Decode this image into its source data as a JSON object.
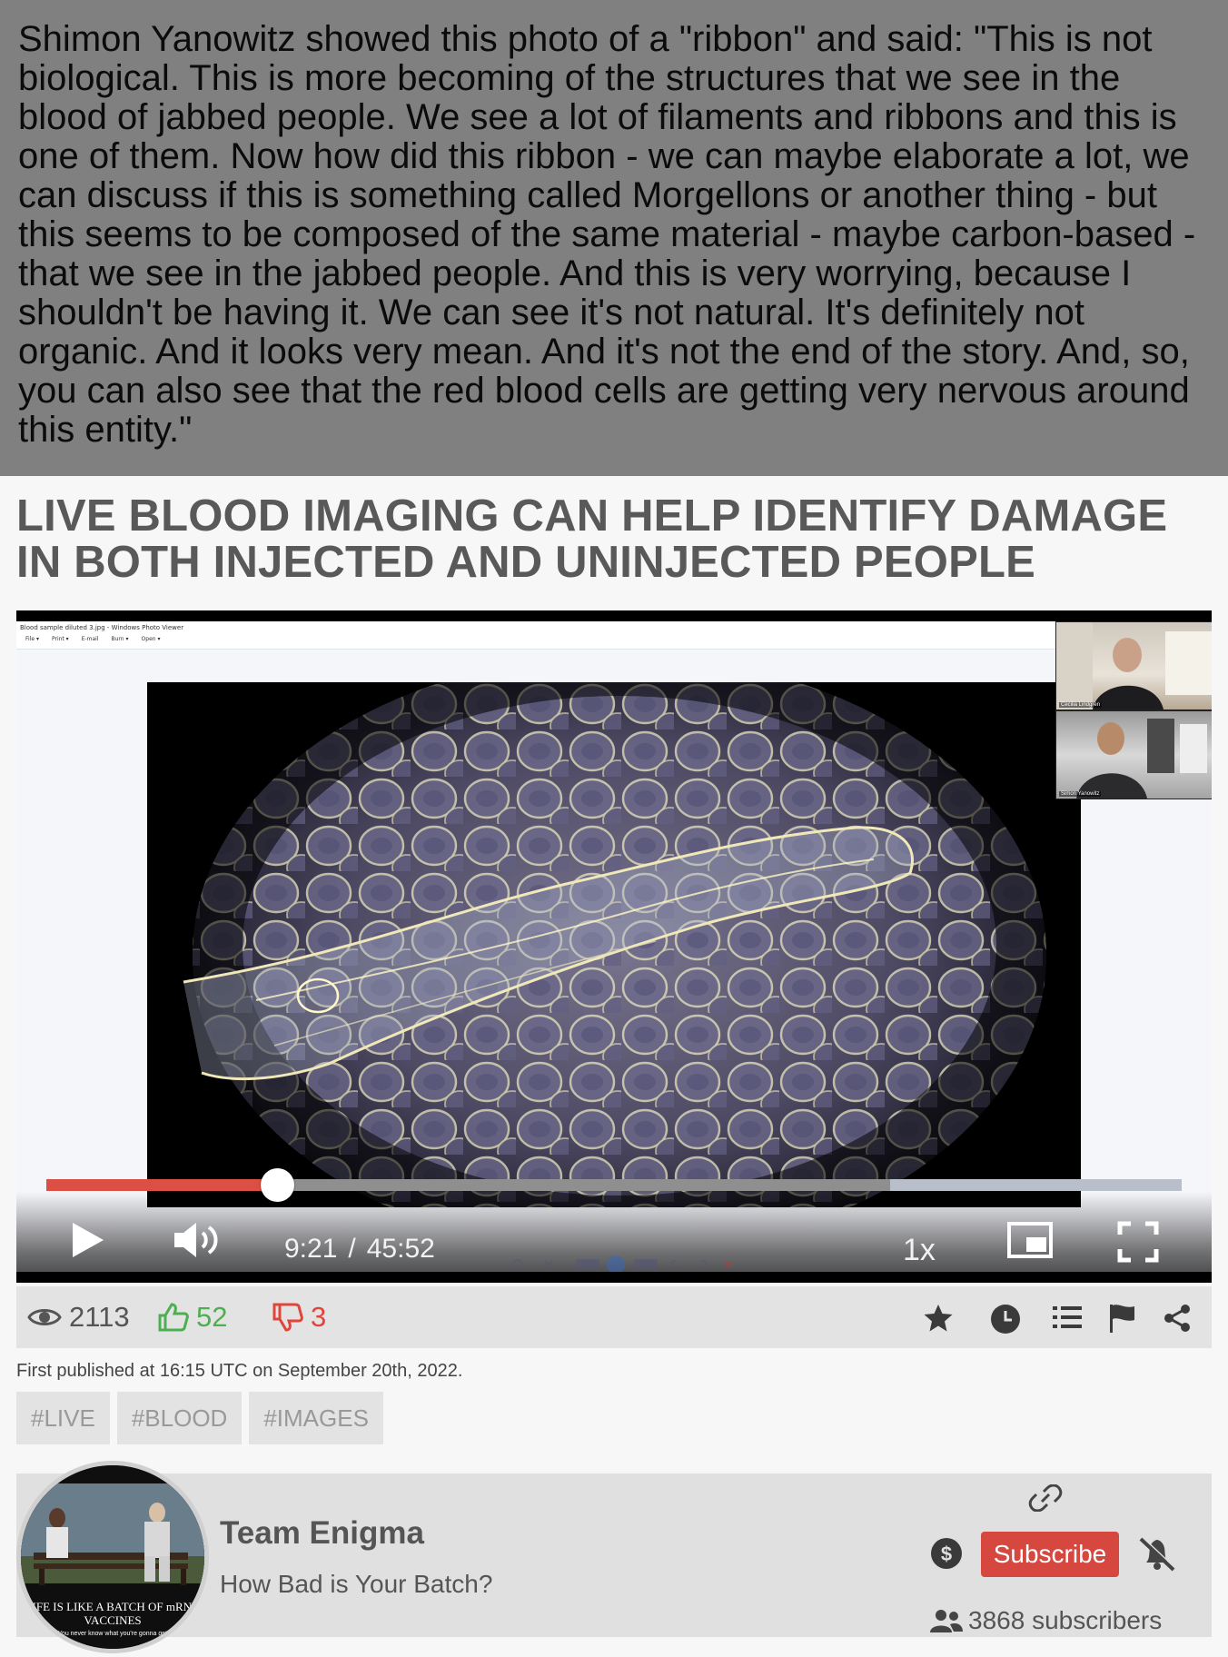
{
  "quote": {
    "text": "Shimon Yanowitz showed this photo of a \"ribbon\" and said: \"This is not biological. This is more becoming of the structures that we see in the blood of jabbed people. We see a lot of filaments and ribbons and this is one of them. Now how did this ribbon - we can maybe elaborate a lot, we can discuss if this is something called Morgellons or another thing - but this seems to be composed of the same material - maybe carbon-based - that we see in the jabbed people. And this is very worrying, because I shouldn't be having it. We can see it's not natural. It's definitely not organic. And it looks very mean. And it's not the end of the story. And, so, you can also see that the red blood cells are getting very nervous around this entity.\""
  },
  "headline": "LIVE BLOOD IMAGING CAN HELP IDENTIFY DAMAGE IN BOTH INJECTED AND UNINJECTED PEOPLE",
  "video": {
    "viewer_title": "Blood sample diluted 3.jpg - Windows Photo Viewer",
    "viewer_menu": [
      "File ▾",
      "Print ▾",
      "E-mail",
      "Burn ▾",
      "Open ▾"
    ],
    "participants": [
      "Cecilia Lindgren",
      "Simon Yanowitz"
    ],
    "current_time": "9:21",
    "time_separator": "/",
    "duration": "45:52",
    "progress_played": 0.203,
    "progress_buffered": 0.743,
    "speed": "1x",
    "colors": {
      "played": "#db4f44",
      "buffered": "#8f8f8f",
      "track": "#b9bfca"
    }
  },
  "stats": {
    "views": "2113",
    "likes": "52",
    "dislikes": "3",
    "colors": {
      "likes": "#4caf50",
      "dislikes": "#e0443a"
    },
    "actions": [
      "star-icon",
      "clock-icon",
      "list-icon",
      "flag-icon",
      "share-icon"
    ]
  },
  "published": "First published at 16:15 UTC on September 20th, 2022.",
  "tags": [
    "#LIVE",
    "#BLOOD",
    "#IMAGES"
  ],
  "channel": {
    "name": "Team Enigma",
    "tagline": "How Bad is Your Batch?",
    "avatar_text": "LIFE IS LIKE A BATCH OF mRNA VACCINES",
    "avatar_subtext": "You never know what you're gonna get",
    "subscribe_label": "Subscribe",
    "subscribers": "3868 subscribers",
    "subscribe_color": "#d5473f"
  }
}
